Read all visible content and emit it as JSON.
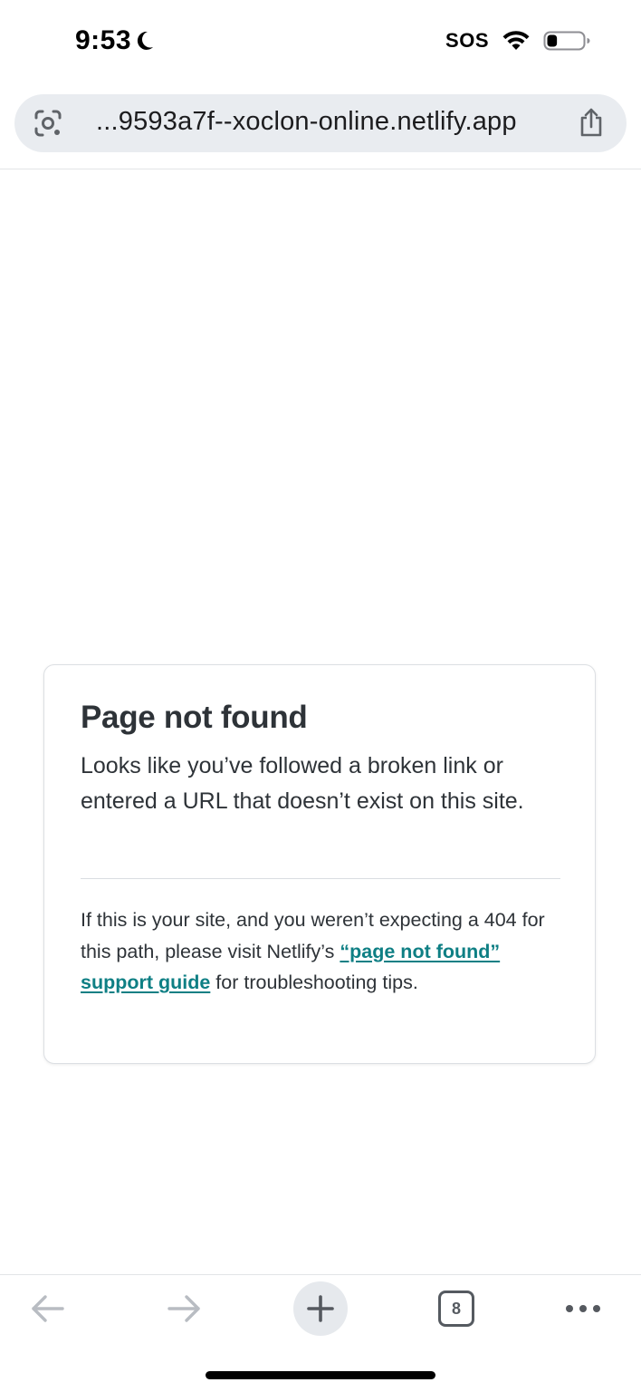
{
  "status_bar": {
    "time": "9:53",
    "sos": "SOS",
    "icons": [
      "moon-icon",
      "wifi-icon",
      "battery-icon"
    ]
  },
  "address_bar": {
    "url": "...9593a7f--xoclon-online.netlify.app",
    "icons": [
      "google-lens-icon",
      "share-icon"
    ]
  },
  "card": {
    "title": "Page not found",
    "message": "Looks like you’ve followed a broken link or entered a URL that doesn’t exist on this site.",
    "help_before": "If this is your site, and you weren’t expecting a 404 for this path, please visit Netlify’s ",
    "help_link": "“page not found” support guide",
    "help_after": " for troubleshooting tips.",
    "link_color": "#0e7f84"
  },
  "toolbar": {
    "tab_count": "8",
    "icons": [
      "back-arrow-icon",
      "forward-arrow-icon",
      "plus-icon",
      "tabs-icon",
      "more-icon"
    ]
  },
  "battery": {
    "level": 0.28
  }
}
